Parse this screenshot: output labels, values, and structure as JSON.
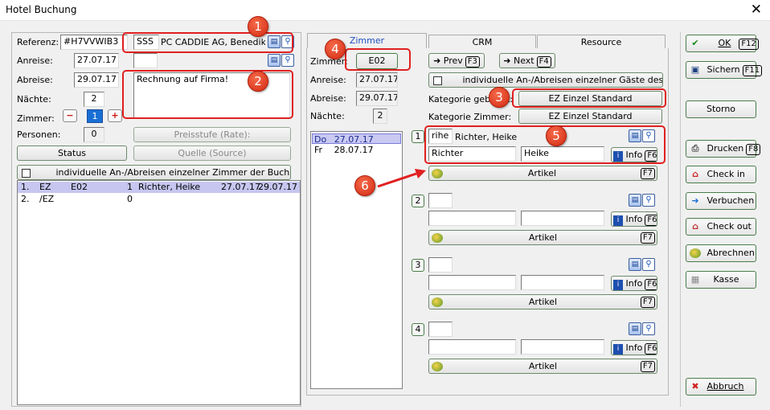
{
  "window": {
    "title": "Hotel Buchung",
    "close_glyph": "✕"
  },
  "left": {
    "referenz_label": "Referenz:",
    "referenz_value": "#H7VVWIB3",
    "sss_value": "SSS",
    "company_value": "PC CADDIE AG, Benedikt S",
    "anreise_label": "Anreise:",
    "anreise_value": "27.07.17",
    "abreise_label": "Abreise:",
    "abreise_value": "29.07.17",
    "naechte_label": "Nächte:",
    "naechte_value": "2",
    "zimmer_label": "Zimmer:",
    "zimmer_value": "1",
    "personen_label": "Personen:",
    "personen_value": "0",
    "note_value": "Rechnung auf Firma!",
    "preisstufe_label": "Preisstufe (Rate):",
    "quelle_label": "Quelle (Source)",
    "status_label": "Status",
    "individual_label": "individuelle An-/Abreisen einzelner Zimmer der Buchung",
    "rooms": [
      {
        "nr": "1.",
        "cat": "EZ",
        "room": "E02",
        "count": "1",
        "name": "Richter, Heike",
        "from": "27.07.17",
        "to": "29.07.17"
      },
      {
        "nr": "2.",
        "cat": "/EZ",
        "room": "",
        "count": "0",
        "name": "",
        "from": "",
        "to": ""
      }
    ]
  },
  "tabs": [
    {
      "label": "Zimmer"
    },
    {
      "label": "CRM"
    },
    {
      "label": "Resource"
    }
  ],
  "mid": {
    "zimmer_label": "Zimmer:",
    "zimmer_btn": "E02",
    "anreise_label": "Anreise:",
    "anreise_value": "27.07.17",
    "abreise_label": "Abreise:",
    "abreise_value": "29.07.17",
    "naechte_label": "Nächte:",
    "naechte_value": "2",
    "days": [
      {
        "day": "Do",
        "date": "27.07.17"
      },
      {
        "day": "Fr",
        "date": "28.07.17"
      }
    ]
  },
  "right": {
    "prev_label": "Prev",
    "prev_key": "F3",
    "next_label": "Next",
    "next_key": "F4",
    "individual_guests_label": "individuelle An-/Abreisen einzelner Gäste des Zi.",
    "kat_gebucht_label": "Kategorie gebucht:",
    "kat_gebucht_value": "EZ Einzel Standard",
    "kat_zimmer_label": "Kategorie Zimmer:",
    "kat_zimmer_value": "EZ Einzel Standard",
    "info_label": "Info",
    "info_key": "F6",
    "artikel_label": "Artikel",
    "artikel_key": "F7",
    "guests": [
      {
        "num": "1",
        "code": "rihe",
        "name": "Richter, Heike",
        "last": "Richter",
        "first": "Heike"
      },
      {
        "num": "2",
        "code": "",
        "name": "",
        "last": "",
        "first": ""
      },
      {
        "num": "3",
        "code": "",
        "name": "",
        "last": "",
        "first": ""
      },
      {
        "num": "4",
        "code": "",
        "name": "",
        "last": "",
        "first": ""
      }
    ]
  },
  "side": {
    "ok_label": "OK",
    "ok_key": "F12",
    "sichern_label": "Sichern",
    "sichern_key": "F11",
    "storno_label": "Storno",
    "drucken_label": "Drucken",
    "drucken_key": "F8",
    "checkin_label": "Check in",
    "verbuchen_label": "Verbuchen",
    "checkout_label": "Check out",
    "abrechnen_label": "Abrechnen",
    "kasse_label": "Kasse",
    "abbruch_label": "Abbruch"
  },
  "callouts": [
    "1",
    "2",
    "3",
    "4",
    "5",
    "6"
  ],
  "colors": {
    "selected_row": "#c6c6f0",
    "callout": "#e02020",
    "accent_blue": "#2050c0"
  }
}
